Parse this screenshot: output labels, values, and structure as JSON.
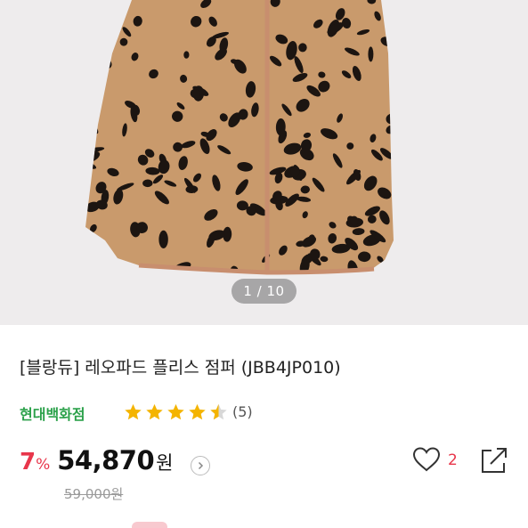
{
  "gallery": {
    "counter": "1 / 10",
    "colors": {
      "background": "#eeeced",
      "fur": "#c99a6c",
      "spots": "#1c1511",
      "piping": "#c88e6e"
    }
  },
  "product": {
    "title": "[블랑듀] 레오파드 플리스 점퍼 (JBB4JP010)",
    "seller": "현대백화점",
    "rating": 4.5,
    "review_count": "(5)",
    "discount": "7",
    "discount_unit": "%",
    "price": "54,870",
    "price_unit": "원",
    "original_price": "59,000원"
  },
  "actions": {
    "like_count": "2",
    "icons": [
      "heart-icon",
      "share-icon",
      "chevron-right-icon"
    ]
  },
  "colors": {
    "accent": "#e8364b",
    "seller": "#2ba14a",
    "star": "#f4b400",
    "text": "#222222"
  }
}
